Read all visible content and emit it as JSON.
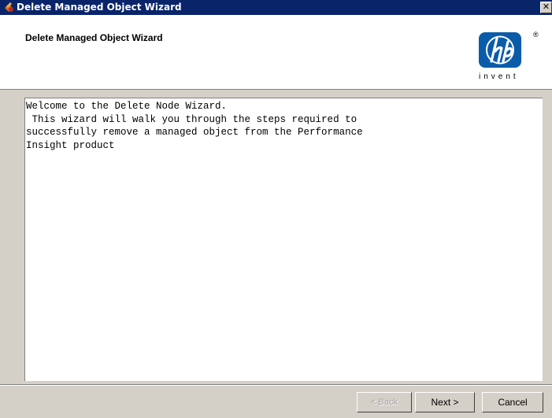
{
  "window": {
    "title": "Delete Managed Object Wizard",
    "close_label": "✕",
    "icon": "app-icon"
  },
  "header": {
    "title": "Delete Managed Object Wizard",
    "logo": {
      "icon": "hp-logo",
      "tagline": "invent",
      "registered": "®"
    }
  },
  "content": {
    "text": "Welcome to the Delete Node Wizard.\n This wizard will walk you through the steps required to\nsuccessfully remove a managed object from the Performance\nInsight product"
  },
  "buttons": {
    "back": "< Back",
    "next": "Next >",
    "cancel": "Cancel"
  },
  "colors": {
    "titlebar": "#0a246a",
    "dialog": "#d4d0c8",
    "logo_blue": "#0a5ca8"
  }
}
